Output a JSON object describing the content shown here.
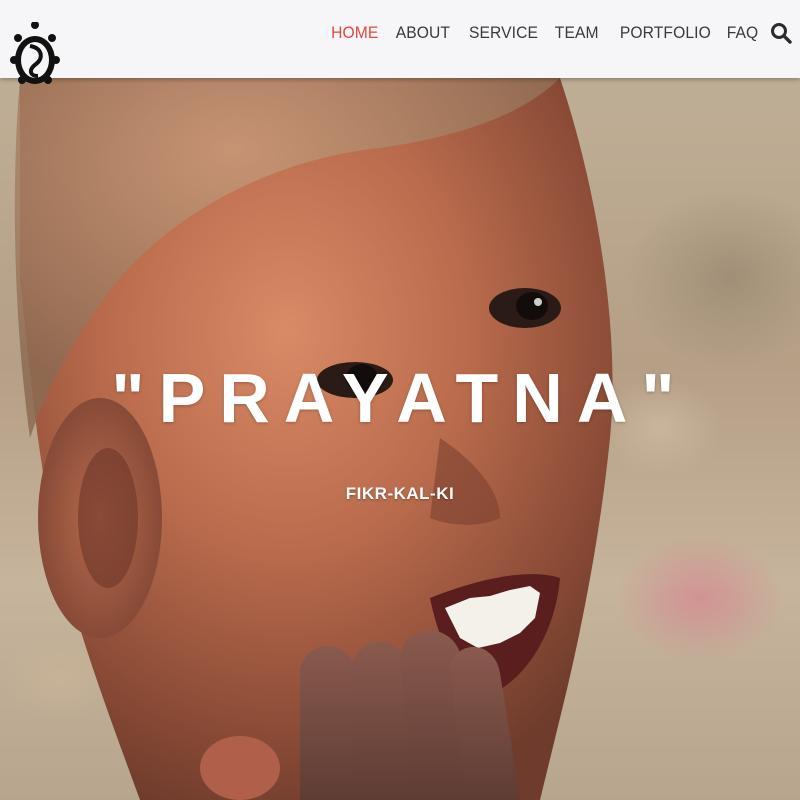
{
  "header": {
    "logo": {
      "icon": "turtle-logo-icon"
    },
    "nav": {
      "items": [
        {
          "label": "HOME",
          "active": true
        },
        {
          "label": "ABOUT"
        },
        {
          "label": "SERVICE"
        },
        {
          "label": "TEAM"
        },
        {
          "label": "PORTFOLIO"
        },
        {
          "label": "FAQ"
        }
      ],
      "search_icon": "search-icon"
    }
  },
  "hero": {
    "title": "\"PRAYATNA\"",
    "subtitle": "FIKR-KAL-KI",
    "background": "photo of a smiling child with hands at mouth"
  },
  "colors": {
    "nav_bg": "#f6f6f8",
    "nav_text": "#3a3a3a",
    "nav_active": "#e0473f",
    "hero_text": "#ffffff"
  }
}
